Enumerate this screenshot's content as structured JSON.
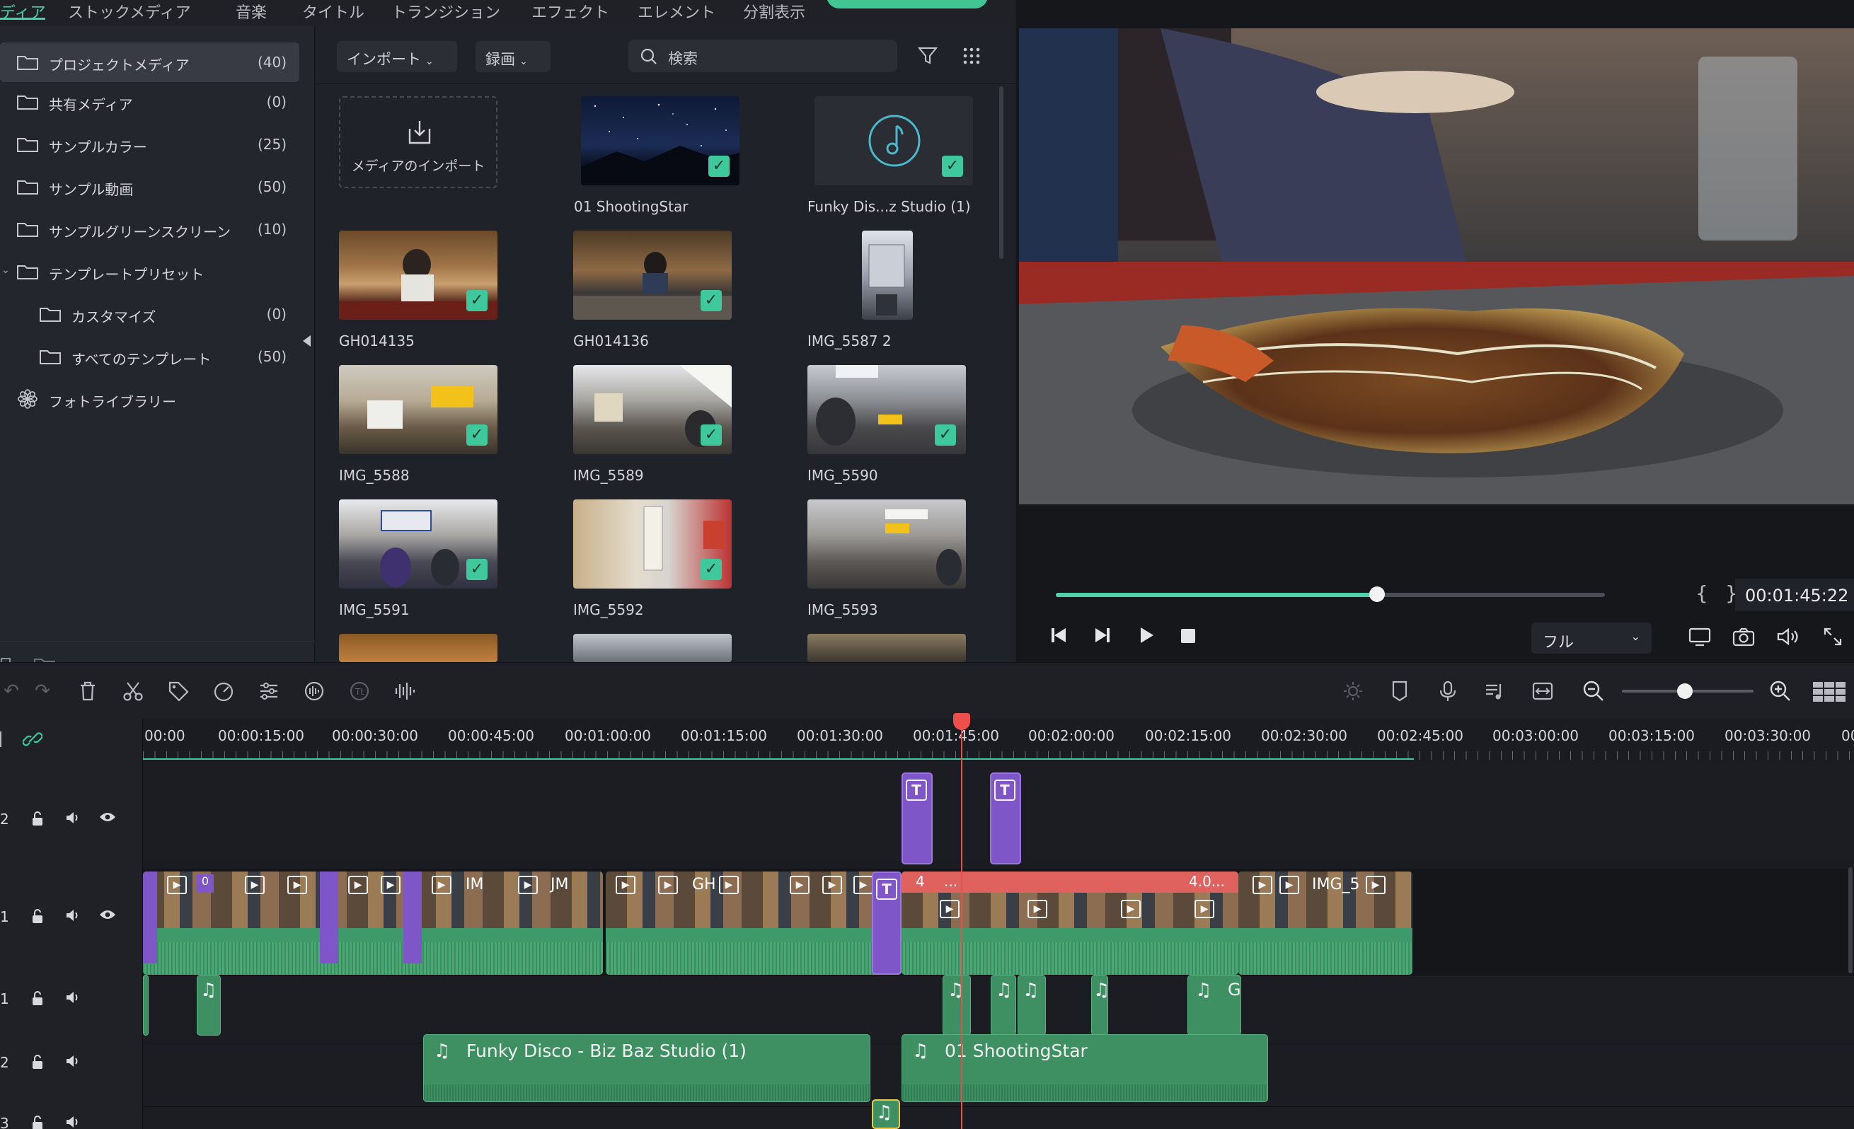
{
  "top_tabs": [
    "ディア",
    "ストックメディア",
    "音楽",
    "タイトル",
    "トランジション",
    "エフェクト",
    "エレメント",
    "分割表示"
  ],
  "sidebar": {
    "items": [
      {
        "label": "プロジェクトメディア",
        "count": "(40)",
        "icon": "folder-icon"
      },
      {
        "label": "共有メディア",
        "count": "(0)",
        "icon": "folder-icon"
      },
      {
        "label": "サンプルカラー",
        "count": "(25)",
        "icon": "folder-icon"
      },
      {
        "label": "サンプル動画",
        "count": "(50)",
        "icon": "folder-icon"
      },
      {
        "label": "サンプルグリーンスクリーン",
        "count": "(10)",
        "icon": "folder-icon"
      },
      {
        "label": "テンプレートプリセット",
        "count": "",
        "icon": "folder-icon"
      },
      {
        "label": "カスタマイズ",
        "count": "(0)",
        "icon": "folder-icon"
      },
      {
        "label": "すべてのテンプレート",
        "count": "(50)",
        "icon": "folder-icon"
      },
      {
        "label": "フォトライブラリー",
        "count": "",
        "icon": "photos-icon"
      }
    ]
  },
  "media_toolbar": {
    "import_label": "インポート",
    "record_label": "録画",
    "search_placeholder": "検索"
  },
  "media": {
    "import_card_label": "メディアのインポート",
    "items": [
      {
        "label": "01 ShootingStar",
        "kind": "night-sky"
      },
      {
        "label": "Funky Dis...z Studio (1)",
        "kind": "music"
      },
      {
        "label": "GH014135",
        "kind": "restaurant"
      },
      {
        "label": "GH014136",
        "kind": "restaurant"
      },
      {
        "label": "IMG_5587 2",
        "kind": "vertical"
      },
      {
        "label": "IMG_5588",
        "kind": "street"
      },
      {
        "label": "IMG_5589",
        "kind": "street"
      },
      {
        "label": "IMG_5590",
        "kind": "street"
      },
      {
        "label": "IMG_5591",
        "kind": "street"
      },
      {
        "label": "IMG_5592",
        "kind": "street"
      },
      {
        "label": "IMG_5593",
        "kind": "street"
      }
    ]
  },
  "preview": {
    "timecode": "00:01:45:22",
    "progress": 0.585,
    "quality": "フル",
    "bracket_in": "{",
    "bracket_out": "}"
  },
  "timeline": {
    "ruler_labels": [
      "00:00",
      "00:00:15:00",
      "00:00:30:00",
      "00:00:45:00",
      "00:01:00:00",
      "00:01:15:00",
      "00:01:30:00",
      "00:01:45:00",
      "00:02:00:00",
      "00:02:15:00",
      "00:02:30:00",
      "00:02:45:00",
      "00:03:00:00",
      "00:03:15:00",
      "00:03:30:00",
      "00"
    ],
    "tracks": [
      {
        "num": "2"
      },
      {
        "num": "1"
      },
      {
        "num": "1"
      },
      {
        "num": "2"
      },
      {
        "num": "3"
      }
    ],
    "audio_clips": {
      "funky": "Funky Disco - Biz Baz Studio (1)",
      "shooting": "01 ShootingStar",
      "g_label": "G"
    },
    "video_labels": {
      "im": "IM",
      "jm": "JM",
      "gh": "GH",
      "img": "IMG_5",
      "four": "4.0...",
      "zero": "0",
      "fr1": "4",
      "fr2": "..."
    },
    "zoom_level": 0.42
  },
  "colors": {
    "accent": "#44d3a8",
    "title_clip": "#7e56c8",
    "video_clip": "#3f9a6b",
    "playhead": "#ef4f4a"
  }
}
